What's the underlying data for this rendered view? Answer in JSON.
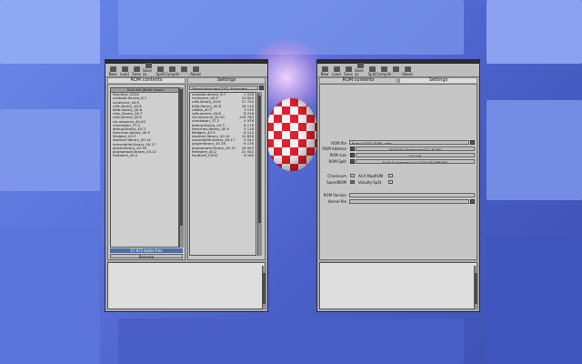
{
  "toolbar_left": [
    {
      "label": "New",
      "enabled": true
    },
    {
      "label": "Load",
      "enabled": true
    },
    {
      "label": "Save",
      "enabled": true
    },
    {
      "label": "Save as",
      "enabled": true
    },
    {
      "label": "Split",
      "enabled": true
    },
    {
      "label": "Compile",
      "enabled": true
    },
    {
      "label": "??????",
      "enabled": false
    },
    {
      "label": "About",
      "enabled": true
    }
  ],
  "toolbar_right": [
    {
      "label": "New",
      "enabled": true
    },
    {
      "label": "Load",
      "enabled": true
    },
    {
      "label": "Save",
      "enabled": true
    },
    {
      "label": "Save as",
      "enabled": true
    },
    {
      "label": "Split",
      "enabled": true
    },
    {
      "label": "Compile",
      "enabled": true
    },
    {
      "label": "??????",
      "enabled": false
    },
    {
      "label": "About",
      "enabled": true
    }
  ],
  "left_window": {
    "tabs": {
      "rom_contents": "ROM contents",
      "settings": "Settings"
    },
    "rom_list_header": "Kick Set (Build issue)",
    "rom_list": [
      "RomDisk_CD32",
      "scsiboot.device_6.7",
      "nd.device_40.9",
      "cdfs.library_40.6",
      "bflib.library_40.6",
      "cdtv_library_40.7",
      "cdfs.device_40.8",
      "cia.resource_40.40",
      "checkatari_37.2",
      "debug.library_40.3",
      "timerrms.library_40.5",
      "Modgen_40.3",
      "lowlevel.library_40.14",
      "nonvolatile.library_40.17",
      "playerlibrary_40.16",
      "playsample.library_40.12",
      "freeanim_40.2"
    ],
    "status": "27 672 bytes free",
    "button": "Rename",
    "dropdown_label": "[Roms/Modules/CD32_Extended",
    "module_list": [
      {
        "name": "scsiboot.device_6.7",
        "size": "1 028"
      },
      {
        "name": "nd.device_40.9",
        "size": "10 604"
      },
      {
        "name": "cdfs.library_40.6",
        "size": "17 720"
      },
      {
        "name": "bflib.library_40.6",
        "size": "18 116"
      },
      {
        "name": "cdtitle_40.7",
        "size": "3 132"
      },
      {
        "name": "cdfs.device_40.8",
        "size": "8 216"
      },
      {
        "name": "cia.resource_40.40",
        "size": "249 764"
      },
      {
        "name": "checkatari_37.2",
        "size": "4 976"
      },
      {
        "name": "debug.library_40.3",
        "size": "6 176"
      },
      {
        "name": "timerrms.library_40.5",
        "size": "5 116"
      },
      {
        "name": "Modgen_40.3",
        "size": "6 124"
      },
      {
        "name": "lowlevel.library_40.14",
        "size": "10 828"
      },
      {
        "name": "nonvolatile.library_40.17",
        "size": "5 544"
      },
      {
        "name": "playerlibrary_40.16",
        "size": "6 176"
      },
      {
        "name": "playsample.library_40.12",
        "size": "16 000"
      },
      {
        "name": "freeanim_40.2",
        "size": "21 052"
      },
      {
        "name": "FontDefl_CD32",
        "size": "6 160"
      }
    ]
  },
  "right_window": {
    "tabs": {
      "rom_contents": "ROM contents",
      "settings": "Settings"
    },
    "rom_file_label": "ROM file",
    "rom_file_value": "Roms:CD32_ROM_.rom",
    "rom_address_label": "ROM Address",
    "rom_address_value": "$E00000 (Extended 512 ROM)",
    "rom_size_label": "ROM size",
    "rom_size_value": "512 KB",
    "rom_split_label": "ROM Split",
    "rom_split_value": "Split & swapped (2x 1024 KB EPROM)",
    "checksum_label": "Checksum",
    "checksum_suffix": "ACA MapROM",
    "speedrom_label": "SpeedROM",
    "speedrom_suffix": "Vanulty-Split",
    "rom_version_label": "ROM Version",
    "kernel_file_label": "Kernel file"
  }
}
